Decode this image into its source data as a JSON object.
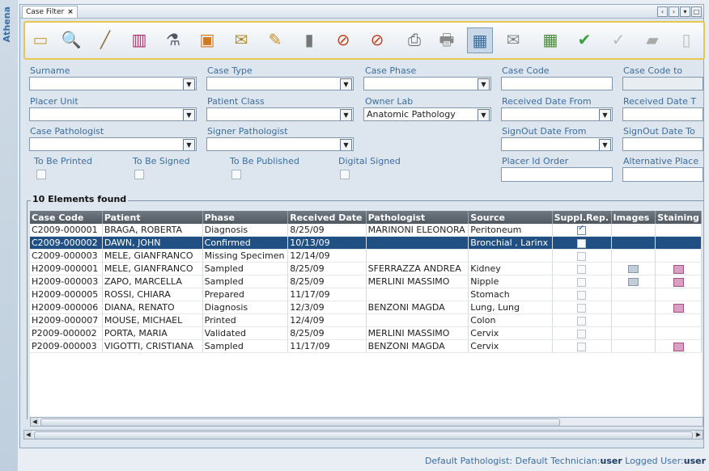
{
  "app": {
    "side_label": "Athena",
    "tab_title": "Case Filter",
    "tab_close": "×"
  },
  "window_controls": [
    "‹",
    "›",
    "▾",
    "□"
  ],
  "toolbar": {
    "icons": [
      "eraser-icon",
      "magnifier-icon",
      "pen-icon",
      "specimen-boxes-icon",
      "microscope-icon",
      "case-folder-icon",
      "edit-paper-icon",
      "notepad-icon",
      "test-tube-icon",
      "scalpel-add-icon",
      "scalpel-remove-icon",
      "print-preview-icon",
      "printer-icon",
      "grid-settings-icon",
      "mail-icon",
      "table-icon",
      "confirm-check-icon",
      "brush-icon",
      "stamp-icon",
      "pdf-icon"
    ],
    "glyphs": [
      "▭",
      "🔍",
      "╱",
      "▥",
      "⚗",
      "▣",
      "✉",
      "✎",
      "▮",
      "⊘",
      "⊘",
      "⎙",
      "🖶",
      "▦",
      "✉",
      "▦",
      "✔",
      "✓",
      "▰",
      "▯"
    ]
  },
  "filters": {
    "surname": {
      "label": "Surname",
      "value": ""
    },
    "case_type": {
      "label": "Case Type",
      "value": ""
    },
    "case_phase": {
      "label": "Case Phase",
      "value": ""
    },
    "case_code": {
      "label": "Case Code",
      "value": ""
    },
    "case_code_to": {
      "label": "Case Code to",
      "value": ""
    },
    "placer_unit": {
      "label": "Placer Unit",
      "value": ""
    },
    "patient_class": {
      "label": "Patient Class",
      "value": ""
    },
    "owner_lab": {
      "label": "Owner Lab",
      "value": "Anatomic Pathology"
    },
    "received_from": {
      "label": "Received Date From",
      "value": ""
    },
    "received_to": {
      "label": "Received Date T",
      "value": ""
    },
    "case_pathologist": {
      "label": "Case Pathologist",
      "value": ""
    },
    "signer_pathologist": {
      "label": "Signer Pathologist",
      "value": ""
    },
    "signout_from": {
      "label": "SignOut Date From",
      "value": ""
    },
    "signout_to": {
      "label": "SignOut Date To",
      "value": ""
    },
    "to_be_printed": {
      "label": "To Be Printed"
    },
    "to_be_signed": {
      "label": "To Be Signed"
    },
    "to_be_published": {
      "label": "To Be Published"
    },
    "digital_signed": {
      "label": "Digital Signed"
    },
    "placer_id_order": {
      "label": "Placer Id Order",
      "value": ""
    },
    "alternative_placer": {
      "label": "Alternative Place",
      "value": ""
    }
  },
  "results": {
    "title": "10 Elements found",
    "columns": [
      "Case Code",
      "Patient",
      "Phase",
      "Received Date",
      "Pathologist",
      "Source",
      "Suppl.Rep.",
      "Images",
      "Staining"
    ],
    "rows": [
      {
        "code": "C2009-000001",
        "patient": "BRAGA, ROBERTA",
        "phase": "Diagnosis",
        "date": "8/25/09",
        "pathologist": "MARINONI ELEONORA",
        "source": "Peritoneum",
        "suppl": true,
        "images": false,
        "staining": false,
        "selected": false
      },
      {
        "code": "C2009-000002",
        "patient": "DAWN, JOHN",
        "phase": "Confirmed",
        "date": "10/13/09",
        "pathologist": "",
        "source": "Bronchial , Larinx",
        "suppl": false,
        "images": false,
        "staining": false,
        "selected": true
      },
      {
        "code": "C2009-000003",
        "patient": "MELE, GIANFRANCO",
        "phase": "Missing Specimen",
        "date": "12/14/09",
        "pathologist": "",
        "source": "",
        "suppl": false,
        "images": false,
        "staining": false,
        "selected": false
      },
      {
        "code": "H2009-000001",
        "patient": "MELE, GIANFRANCO",
        "phase": "Sampled",
        "date": "8/25/09",
        "pathologist": "SFERRAZZA ANDREA",
        "source": "Kidney",
        "suppl": false,
        "images": true,
        "staining": true,
        "selected": false
      },
      {
        "code": "H2009-000003",
        "patient": "ZAPO, MARCELLA",
        "phase": "Sampled",
        "date": "8/25/09",
        "pathologist": "MERLINI MASSIMO",
        "source": "Nipple",
        "suppl": false,
        "images": true,
        "staining": true,
        "selected": false
      },
      {
        "code": "H2009-000005",
        "patient": "ROSSI, CHIARA",
        "phase": "Prepared",
        "date": "11/17/09",
        "pathologist": "",
        "source": "Stomach",
        "suppl": false,
        "images": false,
        "staining": false,
        "selected": false
      },
      {
        "code": "H2009-000006",
        "patient": "DIANA, RENATO",
        "phase": "Diagnosis",
        "date": "12/3/09",
        "pathologist": "BENZONI MAGDA",
        "source": "Lung, Lung",
        "suppl": false,
        "images": false,
        "staining": true,
        "selected": false
      },
      {
        "code": "H2009-000007",
        "patient": "MOUSE, MICHAEL",
        "phase": "Printed",
        "date": "12/4/09",
        "pathologist": "",
        "source": "Colon",
        "suppl": false,
        "images": false,
        "staining": false,
        "selected": false
      },
      {
        "code": "P2009-000002",
        "patient": "PORTA, MARIA",
        "phase": "Validated",
        "date": "8/25/09",
        "pathologist": "MERLINI MASSIMO",
        "source": "Cervix",
        "suppl": false,
        "images": false,
        "staining": false,
        "selected": false
      },
      {
        "code": "P2009-000003",
        "patient": "VIGOTTI, CRISTIANA",
        "phase": "Sampled",
        "date": "11/17/09",
        "pathologist": "BENZONI MAGDA",
        "source": "Cervix",
        "suppl": false,
        "images": false,
        "staining": true,
        "selected": false
      }
    ]
  },
  "status": {
    "pathologist_label": "Default Pathologist:",
    "technician_label": "Default Technician:",
    "technician_value": "user",
    "logged_label": "Logged User:",
    "logged_value": "user"
  }
}
